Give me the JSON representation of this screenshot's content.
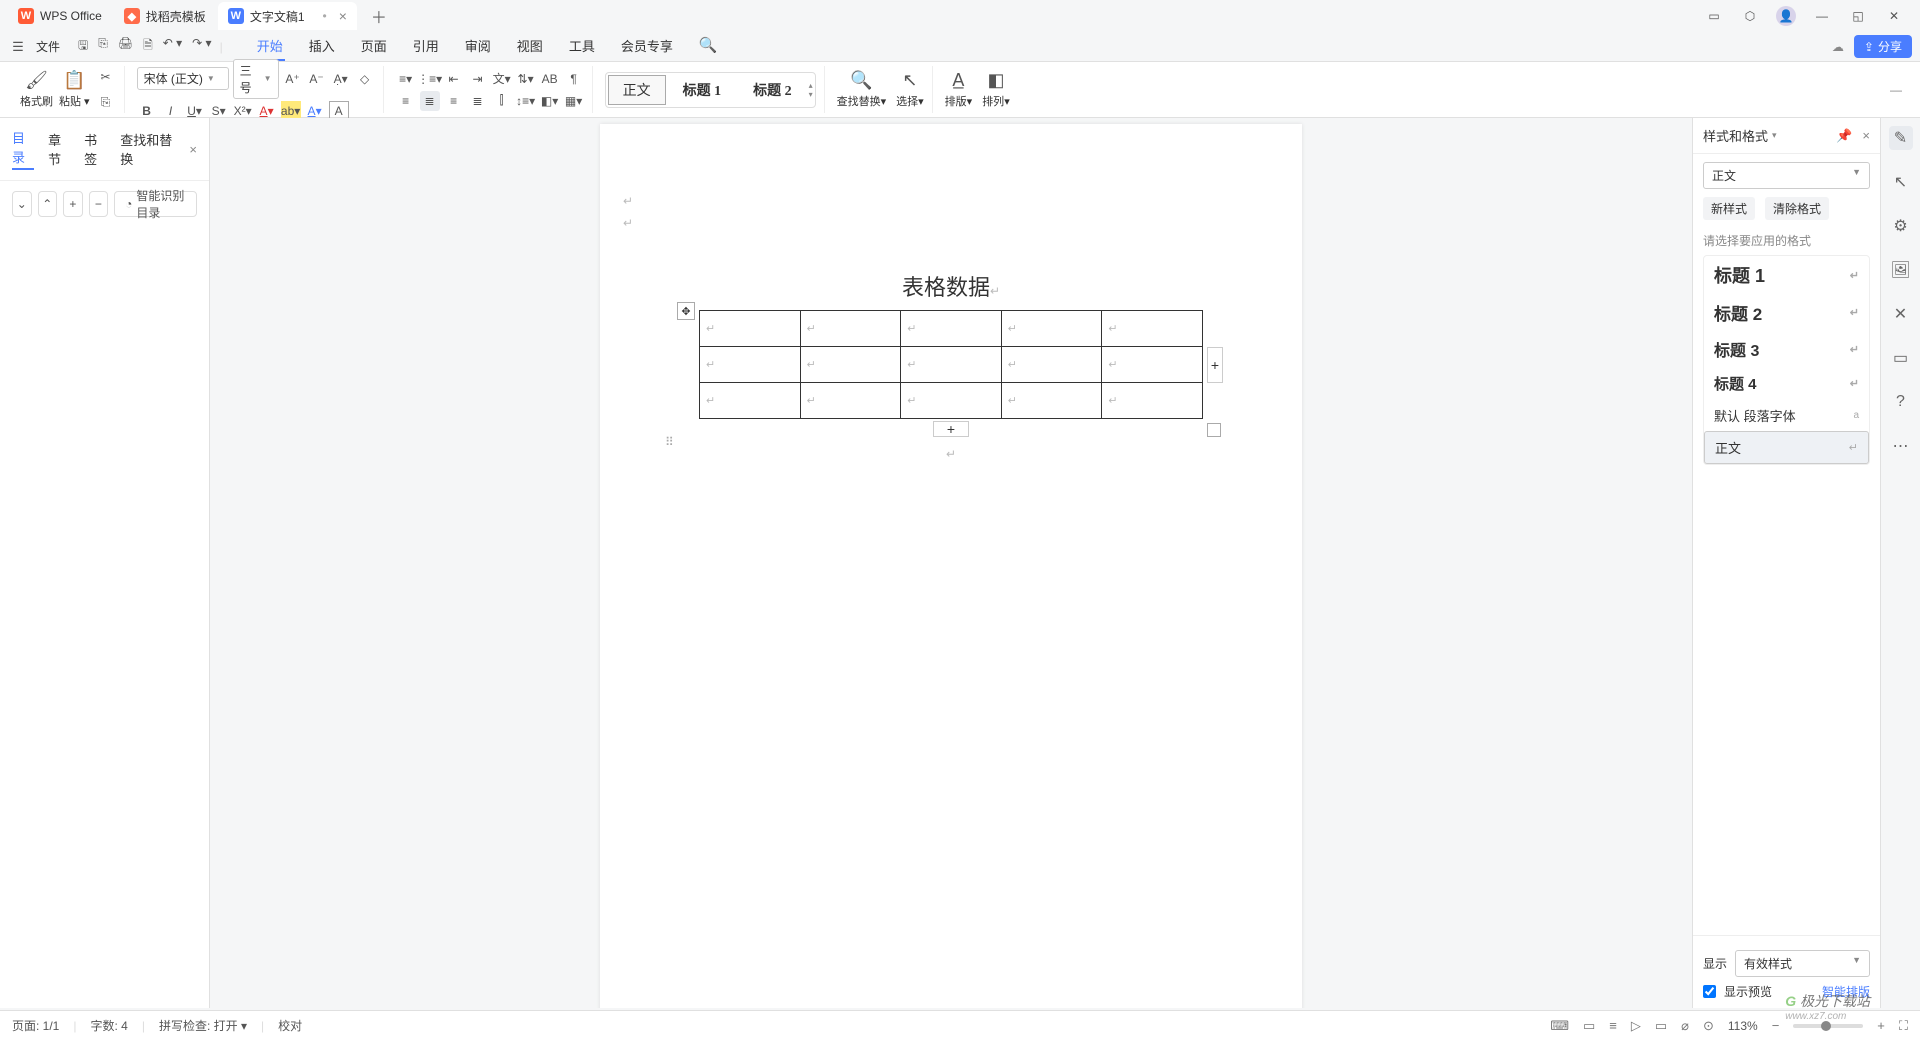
{
  "title_tabs": {
    "t1": "WPS Office",
    "t2": "找稻壳模板",
    "t3": "文字文稿1"
  },
  "menu": {
    "file": "文件",
    "tabs": [
      "开始",
      "插入",
      "页面",
      "引用",
      "审阅",
      "视图",
      "工具",
      "会员专享"
    ]
  },
  "share_label": "分享",
  "ribbon": {
    "format_brush": "格式刷",
    "paste": "粘贴",
    "font_name": "宋体 (正文)",
    "font_size": "三号",
    "style_normal": "正文",
    "style_h1": "标题 1",
    "style_h2": "标题 2",
    "find_replace": "查找替换",
    "select": "选择",
    "layout": "排版",
    "arrange": "排列"
  },
  "left_panel": {
    "tab_toc": "目录",
    "tab_chapter": "章节",
    "tab_bookmark": "书签",
    "tab_findreplace": "查找和替换",
    "smart_toc": "智能识别目录"
  },
  "document": {
    "heading": "表格数据",
    "table_rows": 3,
    "table_cols": 5
  },
  "right_panel": {
    "title": "样式和格式",
    "current_style": "正文",
    "new_style": "新样式",
    "clear_format": "清除格式",
    "hint": "请选择要应用的格式",
    "styles": {
      "h1": "标题 1",
      "h2": "标题 2",
      "h3": "标题 3",
      "h4": "标题 4",
      "default_font": "默认 段落字体",
      "body": "正文"
    },
    "display": "显示",
    "display_sel": "有效样式",
    "show_preview": "显示预览",
    "smart_layout": "智能排版"
  },
  "status": {
    "page": "页面: 1/1",
    "words": "字数: 4",
    "spell": "拼写检查: 打开",
    "proof": "校对",
    "zoom": "113%"
  },
  "watermark": {
    "main": "极光下载站",
    "sub": "www.xz7.com"
  }
}
